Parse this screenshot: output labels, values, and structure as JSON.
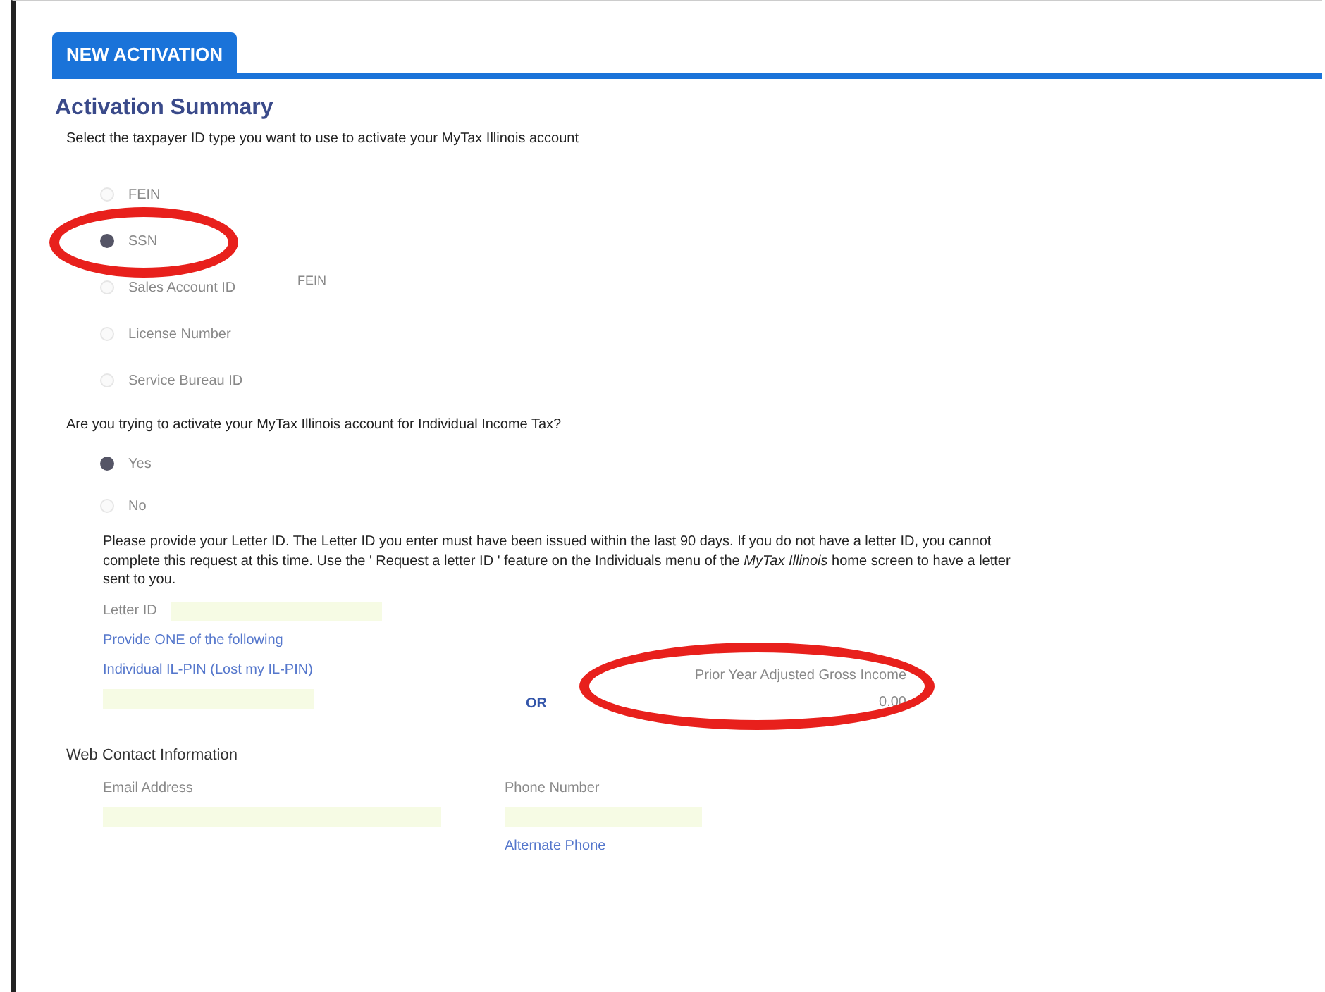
{
  "tab": {
    "label": "NEW ACTIVATION",
    "selected": true
  },
  "title": "Activation Summary",
  "id_question": "Select the taxpayer ID type you want to use to activate your MyTax Illinois account",
  "id_options": [
    {
      "label": "FEIN",
      "selected": false,
      "circled": false
    },
    {
      "label": "SSN",
      "selected": true,
      "circled": true
    },
    {
      "label": "Sales Account ID",
      "selected": false,
      "circled": false
    },
    {
      "label": "License Number",
      "selected": false,
      "circled": false
    },
    {
      "label": "Service Bureau ID",
      "selected": false,
      "circled": false
    }
  ],
  "side_note": "FEIN",
  "income_question": "Are you trying to activate your MyTax Illinois account for Individual Income Tax?",
  "income_options": [
    {
      "label": "Yes",
      "selected": true
    },
    {
      "label": "No",
      "selected": false
    }
  ],
  "instructions": "Please provide your Letter ID. The Letter ID you enter must have been issued within the last 90 days. If you do not have a letter ID, you cannot complete this request at this time. Use the ' Request a letter ID ' feature on the Individuals menu of the *MyTax Illinois* home screen to have a letter sent to you.",
  "letter_id_label": "Letter ID",
  "provide_one": "Provide ONE of the following",
  "pin_label": "Individual IL-PIN (Lost my IL-PIN)",
  "or_label": "OR",
  "agi": {
    "label": "Prior Year Adjusted Gross Income",
    "value": "0.00",
    "circled": true
  },
  "contact": {
    "heading": "Web Contact Information",
    "fields": [
      "Email Address",
      "Phone Number"
    ],
    "alternate": "Alternate Phone"
  }
}
